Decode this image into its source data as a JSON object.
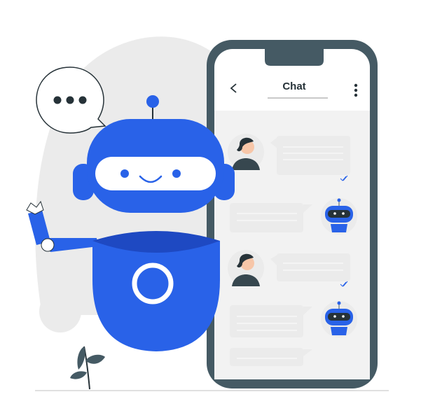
{
  "chat_header": {
    "title": "Chat",
    "back_icon": "chevron-left-icon",
    "menu_icon": "more-vertical-icon"
  },
  "speech_bubble": {
    "icon": "ellipsis-icon"
  },
  "messages": [
    {
      "sender": "user",
      "avatar": "woman-avatar",
      "status_icon": "double-check-icon"
    },
    {
      "sender": "bot",
      "avatar": "robot-avatar"
    },
    {
      "sender": "user",
      "avatar": "woman-avatar",
      "status_icon": "double-check-icon"
    },
    {
      "sender": "bot",
      "avatar": "robot-avatar"
    },
    {
      "sender": "bot",
      "avatar": ""
    }
  ],
  "colors": {
    "primary": "#2962e8",
    "primary_dark": "#1e49c2",
    "phone_frame": "#455a64",
    "bubble": "#ebebeb",
    "background_blob": "#ebebeb"
  }
}
